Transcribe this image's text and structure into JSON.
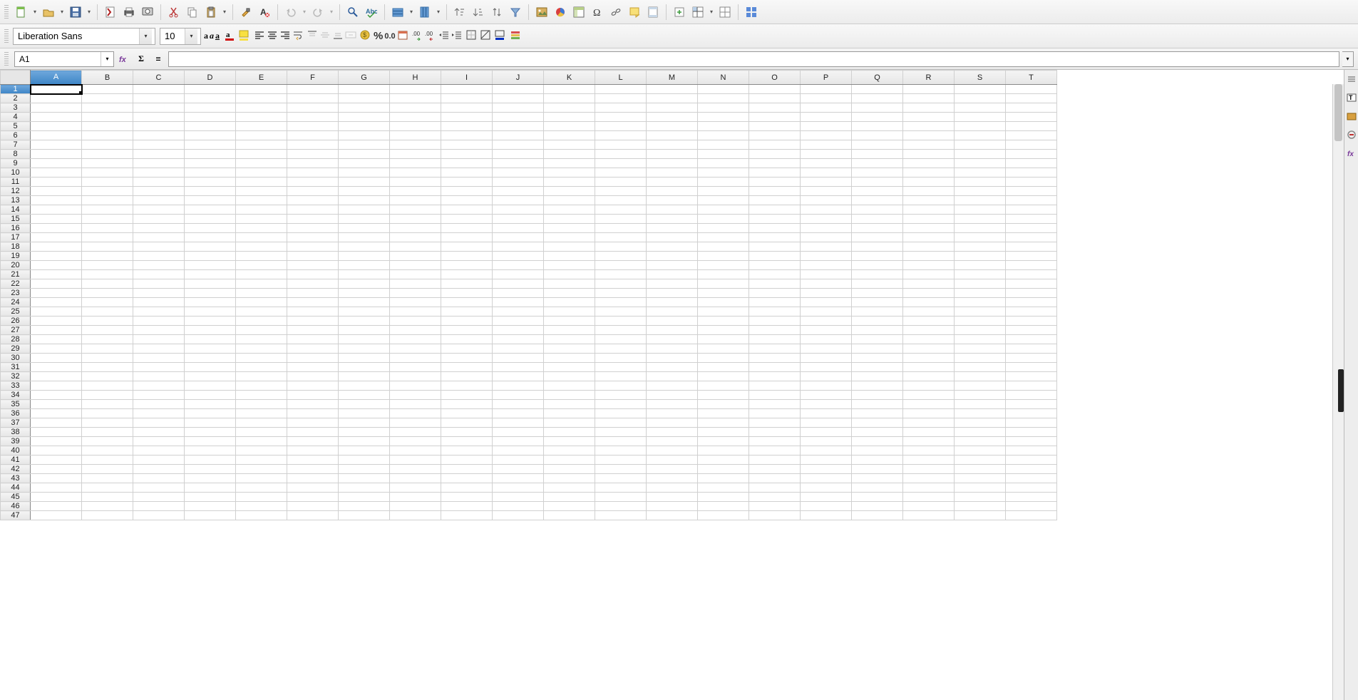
{
  "font_name": "Liberation Sans",
  "font_size": "10",
  "active_cell": "A1",
  "formula_value": "",
  "columns": [
    "A",
    "B",
    "C",
    "D",
    "E",
    "F",
    "G",
    "H",
    "I",
    "J",
    "K",
    "L",
    "M",
    "N",
    "O",
    "P",
    "Q",
    "R",
    "S",
    "T"
  ],
  "rows": 47,
  "selected_col": "A",
  "selected_row": 1,
  "toolbar2": {
    "bold": "a",
    "italic": "a",
    "underline": "a",
    "percent": "%",
    "numfmt": "0.0"
  }
}
